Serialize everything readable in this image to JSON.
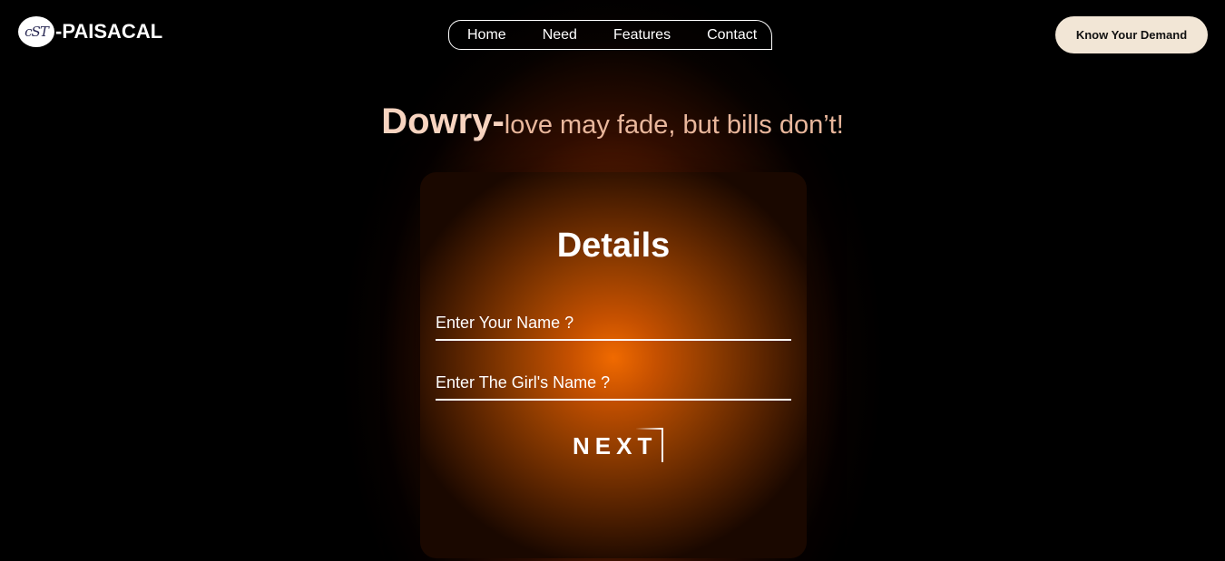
{
  "brand": {
    "logo_mark": "cST",
    "name": "-PAISACAL"
  },
  "nav": {
    "items": [
      {
        "label": "Home"
      },
      {
        "label": "Need"
      },
      {
        "label": "Features"
      },
      {
        "label": "Contact"
      }
    ]
  },
  "header": {
    "cta_label": "Know Your Demand"
  },
  "hero": {
    "headline_strong": "Dowry-",
    "headline_soft": "love may fade, but bills don’t!"
  },
  "form": {
    "title": "Details",
    "name_placeholder": "Enter Your Name ?",
    "girl_placeholder": "Enter The Girl's Name ?",
    "name_value": "",
    "girl_value": "",
    "next_label": "NEXT"
  },
  "colors": {
    "accent": "#f06a00",
    "cta_bg": "#f2e6d6",
    "headline": "#f7d4c0"
  }
}
